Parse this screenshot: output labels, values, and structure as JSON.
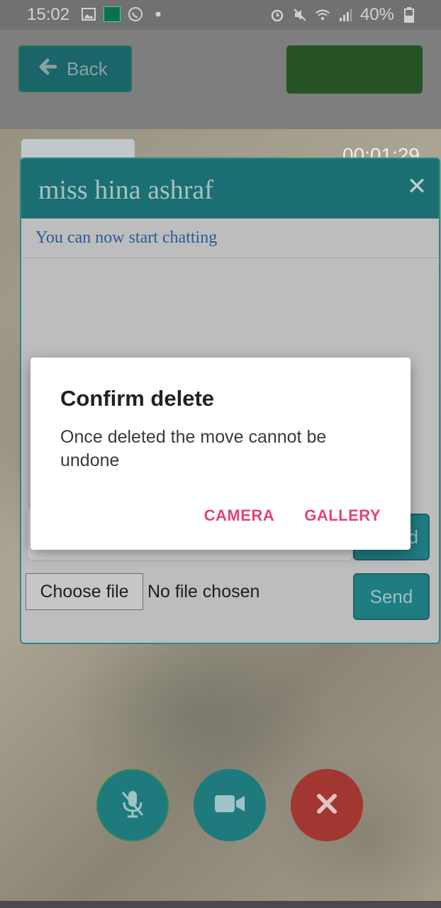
{
  "status_bar": {
    "time": "15:02",
    "battery": "40%",
    "icons": [
      "image-icon",
      "hbl-app-icon",
      "whatsapp-icon",
      "dot-icon",
      "alarm-icon",
      "mute-icon",
      "wifi-icon",
      "signal-icon",
      "battery-icon"
    ]
  },
  "header": {
    "back_label": "Back",
    "back_icon": "arrow-left-icon"
  },
  "call": {
    "timer": "00:01:29"
  },
  "chat": {
    "title": "miss hina ashraf",
    "status_text": "You can now start chatting",
    "send_label_1": "Send",
    "send_label_2": "Send",
    "choose_file_label": "Choose file",
    "no_file_text": "No file chosen"
  },
  "controls": {
    "mic": "mic-off-icon",
    "camera": "video-camera-icon",
    "end": "close-icon"
  },
  "dialog": {
    "title": "Confirm delete",
    "message": "Once deleted the move cannot be undone",
    "camera_label": "CAMERA",
    "gallery_label": "GALLERY"
  },
  "colors": {
    "accent": "#1e7a7d",
    "dialog_action": "#e0447a",
    "end_call": "#a23631"
  }
}
